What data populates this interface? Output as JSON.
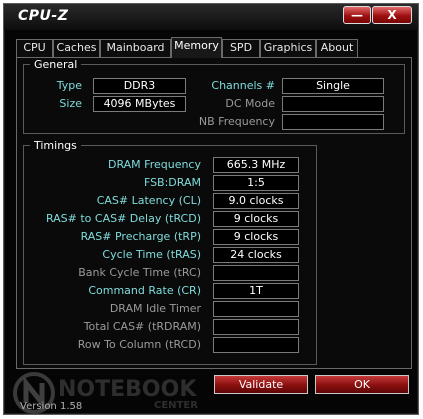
{
  "window": {
    "title": "CPU-Z",
    "minimize_glyph": "—",
    "close_glyph": "X"
  },
  "tabs": [
    "CPU",
    "Caches",
    "Mainboard",
    "Memory",
    "SPD",
    "Graphics",
    "About"
  ],
  "active_tab": "Memory",
  "general": {
    "legend": "General",
    "type_label": "Type",
    "type_value": "DDR3",
    "size_label": "Size",
    "size_value": "4096 MBytes",
    "channels_label": "Channels #",
    "channels_value": "Single",
    "dc_mode_label": "DC Mode",
    "dc_mode_value": "",
    "nb_freq_label": "NB Frequency",
    "nb_freq_value": ""
  },
  "timings": {
    "legend": "Timings",
    "rows": [
      {
        "label": "DRAM Frequency",
        "value": "665.3 MHz",
        "enabled": true
      },
      {
        "label": "FSB:DRAM",
        "value": "1:5",
        "enabled": true
      },
      {
        "label": "CAS# Latency (CL)",
        "value": "9.0 clocks",
        "enabled": true
      },
      {
        "label": "RAS# to CAS# Delay (tRCD)",
        "value": "9 clocks",
        "enabled": true
      },
      {
        "label": "RAS# Precharge (tRP)",
        "value": "9 clocks",
        "enabled": true
      },
      {
        "label": "Cycle Time (tRAS)",
        "value": "24 clocks",
        "enabled": true
      },
      {
        "label": "Bank Cycle Time (tRC)",
        "value": "",
        "enabled": false
      },
      {
        "label": "Command Rate (CR)",
        "value": "1T",
        "enabled": true
      },
      {
        "label": "DRAM Idle Timer",
        "value": "",
        "enabled": false
      },
      {
        "label": "Total CAS# (tRDRAM)",
        "value": "",
        "enabled": false
      },
      {
        "label": "Row To Column (tRCD)",
        "value": "",
        "enabled": false
      }
    ]
  },
  "footer": {
    "watermark": "NOTEBOOK",
    "watermark_sub": "CENTER",
    "validate_label": "Validate",
    "ok_label": "OK",
    "version": "Version 1.58"
  },
  "colors": {
    "accent": "#7fdcdc",
    "button_red": "#8a0f0f",
    "background": "#050505"
  }
}
